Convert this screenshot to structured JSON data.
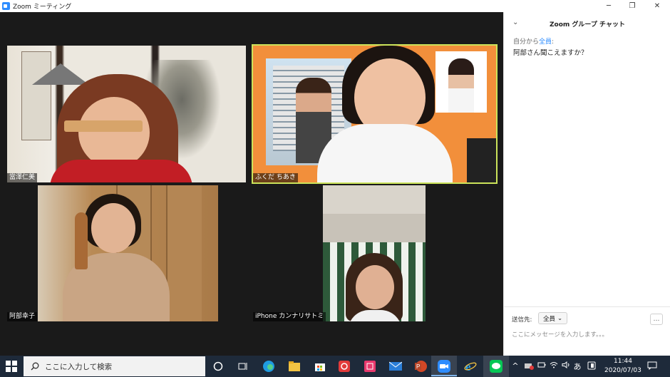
{
  "window": {
    "title": "Zoom ミーティング",
    "minimize": "─",
    "restore": "❐",
    "close": "✕"
  },
  "participants": [
    {
      "name": "當澤仁美"
    },
    {
      "name": "ふくだ ちあき",
      "active_speaker": true
    },
    {
      "name": "阿部幸子"
    },
    {
      "name": "iPhone カンナリサトミ"
    }
  ],
  "chat": {
    "header": "Zoom グループ チャット",
    "collapse_icon": "chevron-down-icon",
    "message": {
      "from": "自分から",
      "to": "全員",
      "text": "阿部さん聞こえますか？"
    },
    "send_to_label": "送信先:",
    "send_to_value": "全員",
    "more": "…",
    "input_placeholder": "ここにメッセージを入力します。。。"
  },
  "taskbar": {
    "search_placeholder": "ここに入力して検索",
    "clock_time": "11:44",
    "clock_date": "2020/07/03",
    "ime": "あ",
    "apps": [
      "cortana-icon",
      "task-view-icon",
      "edge-chromium-icon",
      "file-explorer-icon",
      "store-icon",
      "sync-app-icon",
      "app-icon",
      "mail-icon",
      "powerpoint-icon",
      "zoom-icon",
      "ie-icon",
      "line-icon"
    ]
  },
  "colors": {
    "active_speaker_border": "#cbe35a",
    "zoom_blue": "#2d8cff",
    "taskbar": "#1e2a3a"
  }
}
